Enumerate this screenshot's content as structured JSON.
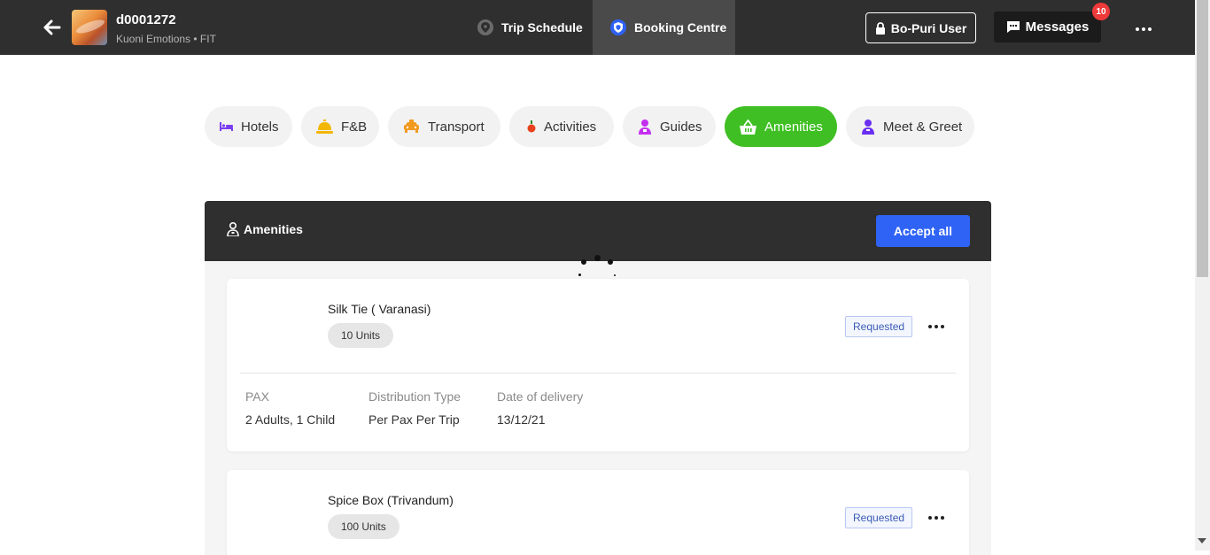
{
  "header": {
    "trip_id": "d0001272",
    "trip_subtitle": "Kuoni Emotions • FIT",
    "tabs": [
      {
        "label": "Trip Schedule",
        "icon": "map-pin-icon"
      },
      {
        "label": "Booking Centre",
        "icon": "shield-icon",
        "active": true
      }
    ],
    "user_label": "Bo-Puri User",
    "messages_label": "Messages",
    "messages_count": "10"
  },
  "categories": [
    {
      "label": "Hotels",
      "icon": "bed-icon",
      "color": "#7a3cf0"
    },
    {
      "label": "F&B",
      "icon": "bell-icon",
      "color": "#f2b705"
    },
    {
      "label": "Transport",
      "icon": "taxi-icon",
      "color": "#f29a1f"
    },
    {
      "label": "Activities",
      "icon": "activity-icon",
      "color": "#e8411d"
    },
    {
      "label": "Guides",
      "icon": "guide-icon",
      "color": "#c52ff0"
    },
    {
      "label": "Amenities",
      "icon": "basket-icon",
      "active": true,
      "color": "#3fbf23"
    },
    {
      "label": "Meet & Greet",
      "icon": "person-icon",
      "color": "#6a2ff0"
    }
  ],
  "panel": {
    "title": "Amenities",
    "accept_all": "Accept all",
    "items": [
      {
        "name": "Silk Tie ( Varanasi)",
        "units": "10 Units",
        "status": "Requested",
        "fields": [
          {
            "label": "PAX",
            "value": "2 Adults, 1 Child"
          },
          {
            "label": "Distribution Type",
            "value": "Per Pax Per Trip"
          },
          {
            "label": "Date of delivery",
            "value": "13/12/21"
          }
        ]
      },
      {
        "name": "Spice Box (Trivandum)",
        "units": "100 Units",
        "status": "Requested"
      }
    ]
  },
  "colors": {
    "topbar": "#2f2f2f",
    "accent_blue": "#2f63f5",
    "accent_green": "#3fbf23",
    "badge_red": "#ee3a3a"
  }
}
